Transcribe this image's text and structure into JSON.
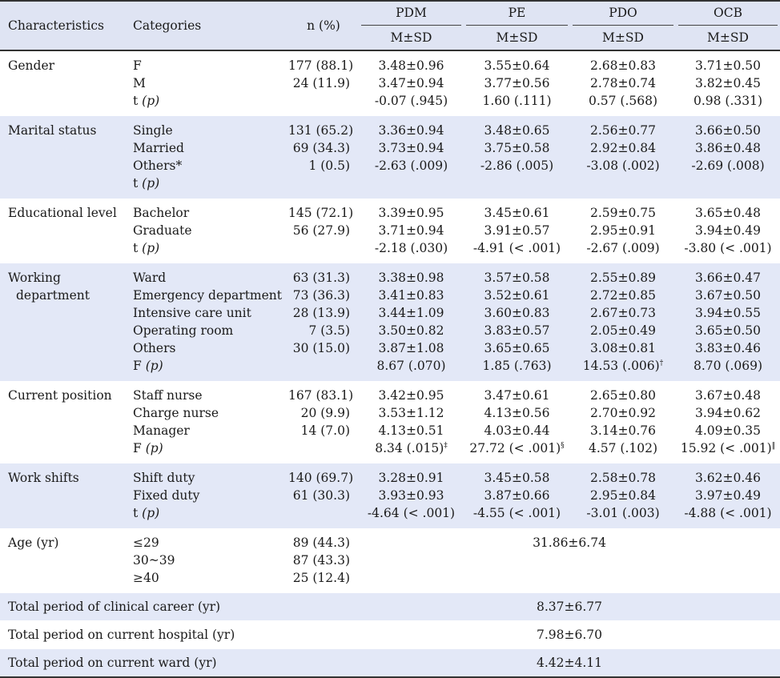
{
  "header": {
    "characteristics": "Characteristics",
    "categories": "Categories",
    "n_pct": "n (%)",
    "groups": [
      "PDM",
      "PE",
      "PDO",
      "OCB"
    ],
    "stat": "M±SD"
  },
  "groups": [
    {
      "label_lines": [
        "Gender"
      ],
      "rows": [
        {
          "cat": "F",
          "n": "177 (88.1)",
          "v": [
            "3.48±0.96",
            "3.55±0.64",
            "2.68±0.83",
            "3.71±0.50"
          ]
        },
        {
          "cat": "M",
          "n": "24 (11.9)",
          "v": [
            "3.47±0.94",
            "3.77±0.56",
            "2.78±0.74",
            "3.82±0.45"
          ]
        },
        {
          "cat": "t",
          "cat_p": "(p)",
          "n": "",
          "v": [
            "-0.07 (.945)",
            "1.60 (.111)",
            "0.57 (.568)",
            "0.98 (.331)"
          ],
          "sup": [
            "",
            "",
            "",
            ""
          ]
        }
      ]
    },
    {
      "label_lines": [
        "Marital status"
      ],
      "rows": [
        {
          "cat": "Single",
          "n": "131 (65.2)",
          "v": [
            "3.36±0.94",
            "3.48±0.65",
            "2.56±0.77",
            "3.66±0.50"
          ]
        },
        {
          "cat": "Married",
          "n": "69 (34.3)",
          "v": [
            "3.73±0.94",
            "3.75±0.58",
            "2.92±0.84",
            "3.86±0.48"
          ]
        },
        {
          "cat": "Others*",
          "n": "1 (0.5)",
          "v": [
            "-2.63 (.009)",
            "-2.86 (.005)",
            "-3.08 (.002)",
            "-2.69 (.008)"
          ]
        },
        {
          "cat": "t",
          "cat_p": "(p)",
          "n": "",
          "v": [
            "",
            "",
            "",
            ""
          ],
          "sup": [
            "",
            "",
            "",
            ""
          ]
        }
      ]
    },
    {
      "label_lines": [
        "Educational level"
      ],
      "rows": [
        {
          "cat": "Bachelor",
          "n": "145 (72.1)",
          "v": [
            "3.39±0.95",
            "3.45±0.61",
            "2.59±0.75",
            "3.65±0.48"
          ]
        },
        {
          "cat": "Graduate",
          "n": "56 (27.9)",
          "v": [
            "3.71±0.94",
            "3.91±0.57",
            "2.95±0.91",
            "3.94±0.49"
          ]
        },
        {
          "cat": "t",
          "cat_p": "(p)",
          "n": "",
          "v": [
            "-2.18 (.030)",
            "-4.91 (< .001)",
            "-2.67 (.009)",
            "-3.80 (< .001)"
          ],
          "sup": [
            "",
            "",
            "",
            ""
          ]
        }
      ]
    },
    {
      "label_lines": [
        "Working",
        "department"
      ],
      "rows": [
        {
          "cat": "Ward",
          "n": "63 (31.3)",
          "v": [
            "3.38±0.98",
            "3.57±0.58",
            "2.55±0.89",
            "3.66±0.47"
          ]
        },
        {
          "cat": "Emergency department",
          "n": "73 (36.3)",
          "v": [
            "3.41±0.83",
            "3.52±0.61",
            "2.72±0.85",
            "3.67±0.50"
          ]
        },
        {
          "cat": "Intensive care unit",
          "n": "28 (13.9)",
          "v": [
            "3.44±1.09",
            "3.60±0.83",
            "2.67±0.73",
            "3.94±0.55"
          ]
        },
        {
          "cat": "Operating room",
          "n": "7 (3.5)",
          "v": [
            "3.50±0.82",
            "3.83±0.57",
            "2.05±0.49",
            "3.65±0.50"
          ]
        },
        {
          "cat": "Others",
          "n": "30 (15.0)",
          "v": [
            "3.87±1.08",
            "3.65±0.65",
            "3.08±0.81",
            "3.83±0.46"
          ]
        },
        {
          "cat": "F",
          "cat_p": "(p)",
          "n": "",
          "v": [
            "8.67 (.070)",
            "1.85 (.763)",
            "14.53 (.006)",
            "8.70 (.069)"
          ],
          "sup": [
            "",
            "",
            "†",
            ""
          ]
        }
      ]
    },
    {
      "label_lines": [
        "Current position"
      ],
      "rows": [
        {
          "cat": "Staff nurse",
          "n": "167 (83.1)",
          "v": [
            "3.42±0.95",
            "3.47±0.61",
            "2.65±0.80",
            "3.67±0.48"
          ]
        },
        {
          "cat": "Charge nurse",
          "n": "20 (9.9)",
          "v": [
            "3.53±1.12",
            "4.13±0.56",
            "2.70±0.92",
            "3.94±0.62"
          ]
        },
        {
          "cat": "Manager",
          "n": "14 (7.0)",
          "v": [
            "4.13±0.51",
            "4.03±0.44",
            "3.14±0.76",
            "4.09±0.35"
          ]
        },
        {
          "cat": "F",
          "cat_p": "(p)",
          "n": "",
          "v": [
            "8.34 (.015)",
            "27.72 (< .001)",
            "4.57 (.102)",
            "15.92 (< .001)"
          ],
          "sup": [
            "‡",
            "§",
            "",
            "‖"
          ]
        }
      ]
    },
    {
      "label_lines": [
        "Work shifts"
      ],
      "rows": [
        {
          "cat": "Shift duty",
          "n": "140 (69.7)",
          "v": [
            "3.28±0.91",
            "3.45±0.58",
            "2.58±0.78",
            "3.62±0.46"
          ]
        },
        {
          "cat": "Fixed duty",
          "n": "61 (30.3)",
          "v": [
            "3.93±0.93",
            "3.87±0.66",
            "2.95±0.84",
            "3.97±0.49"
          ]
        },
        {
          "cat": "t",
          "cat_p": "(p)",
          "n": "",
          "v": [
            "-4.64 (< .001)",
            "-4.55 (< .001)",
            "-3.01 (.003)",
            "-4.88 (< .001)"
          ],
          "sup": [
            "",
            "",
            "",
            ""
          ]
        }
      ]
    }
  ],
  "age": {
    "label": "Age (yr)",
    "cats": [
      "≤29",
      "30~39",
      "≥40"
    ],
    "n": [
      "89 (44.3)",
      "87 (43.3)",
      "25 (12.4)"
    ],
    "value": "31.86±6.74"
  },
  "singles": [
    {
      "label": "Total period of clinical career (yr)",
      "value": "8.37±6.77"
    },
    {
      "label": "Total period on current hospital (yr)",
      "value": "7.98±6.70"
    },
    {
      "label": "Total period on current ward (yr)",
      "value": "4.42±4.11"
    }
  ]
}
